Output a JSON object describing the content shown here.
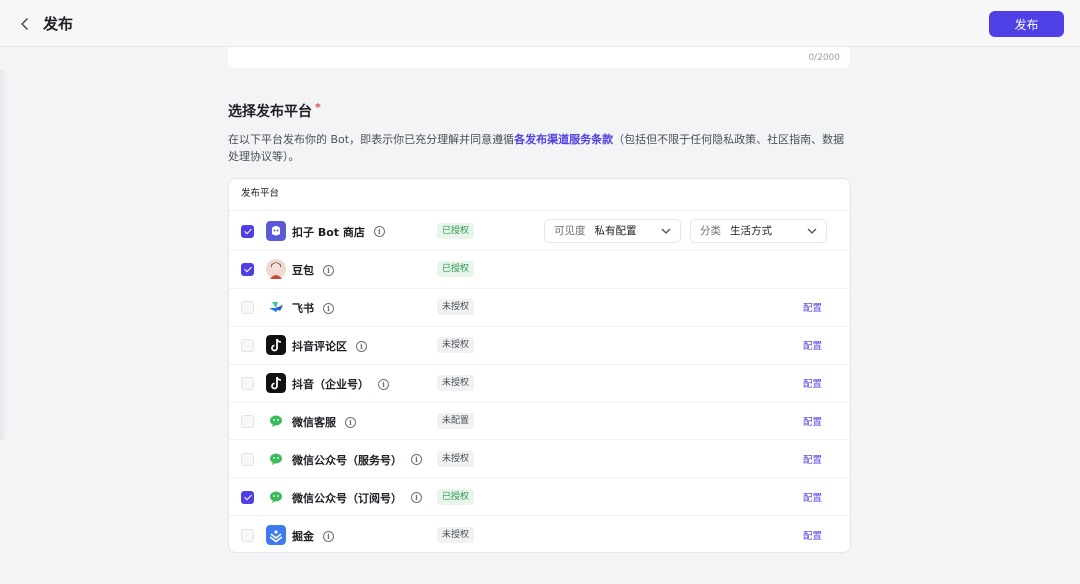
{
  "header": {
    "title": "发布",
    "publish_label": "发布"
  },
  "textarea": {
    "count": "0/2000"
  },
  "section": {
    "title": "选择发布平台",
    "required_mark": "*",
    "desc_before": "在以下平台发布你的 Bot，即表示你已充分理解并同意遵循",
    "desc_link": "各发布渠道服务条款",
    "desc_after": "（包括但不限于任何隐私政策、社区指南、数据处理协议等）。"
  },
  "table": {
    "header": "发布平台",
    "config_label": "配置",
    "visibility": {
      "label": "可见度",
      "value": "私有配置"
    },
    "category": {
      "label": "分类",
      "value": "生活方式"
    },
    "rows": [
      {
        "name": "扣子 Bot 商店",
        "status": "已授权",
        "checked": true,
        "icon": "coze-store-icon",
        "color": "#5a5ad9"
      },
      {
        "name": "豆包",
        "status": "已授权",
        "checked": true,
        "icon": "doubao-icon",
        "color": "#f1d8cf"
      },
      {
        "name": "飞书",
        "status": "未授权",
        "checked": false,
        "icon": "feishu-icon",
        "color": "#ffffff"
      },
      {
        "name": "抖音评论区",
        "status": "未授权",
        "checked": false,
        "icon": "douyin-icon",
        "color": "#111111"
      },
      {
        "name": "抖音（企业号）",
        "status": "未授权",
        "checked": false,
        "icon": "douyin-icon",
        "color": "#111111"
      },
      {
        "name": "微信客服",
        "status": "未配置",
        "checked": false,
        "icon": "wechat-icon",
        "color": "#3dba5c"
      },
      {
        "name": "微信公众号（服务号）",
        "status": "未授权",
        "checked": false,
        "icon": "wechat-icon",
        "color": "#3dba5c"
      },
      {
        "name": "微信公众号（订阅号）",
        "status": "已授权",
        "checked": true,
        "icon": "wechat-icon",
        "color": "#3dba5c"
      },
      {
        "name": "掘金",
        "status": "未授权",
        "checked": false,
        "icon": "juejin-icon",
        "color": "#3e7bf0"
      }
    ]
  }
}
